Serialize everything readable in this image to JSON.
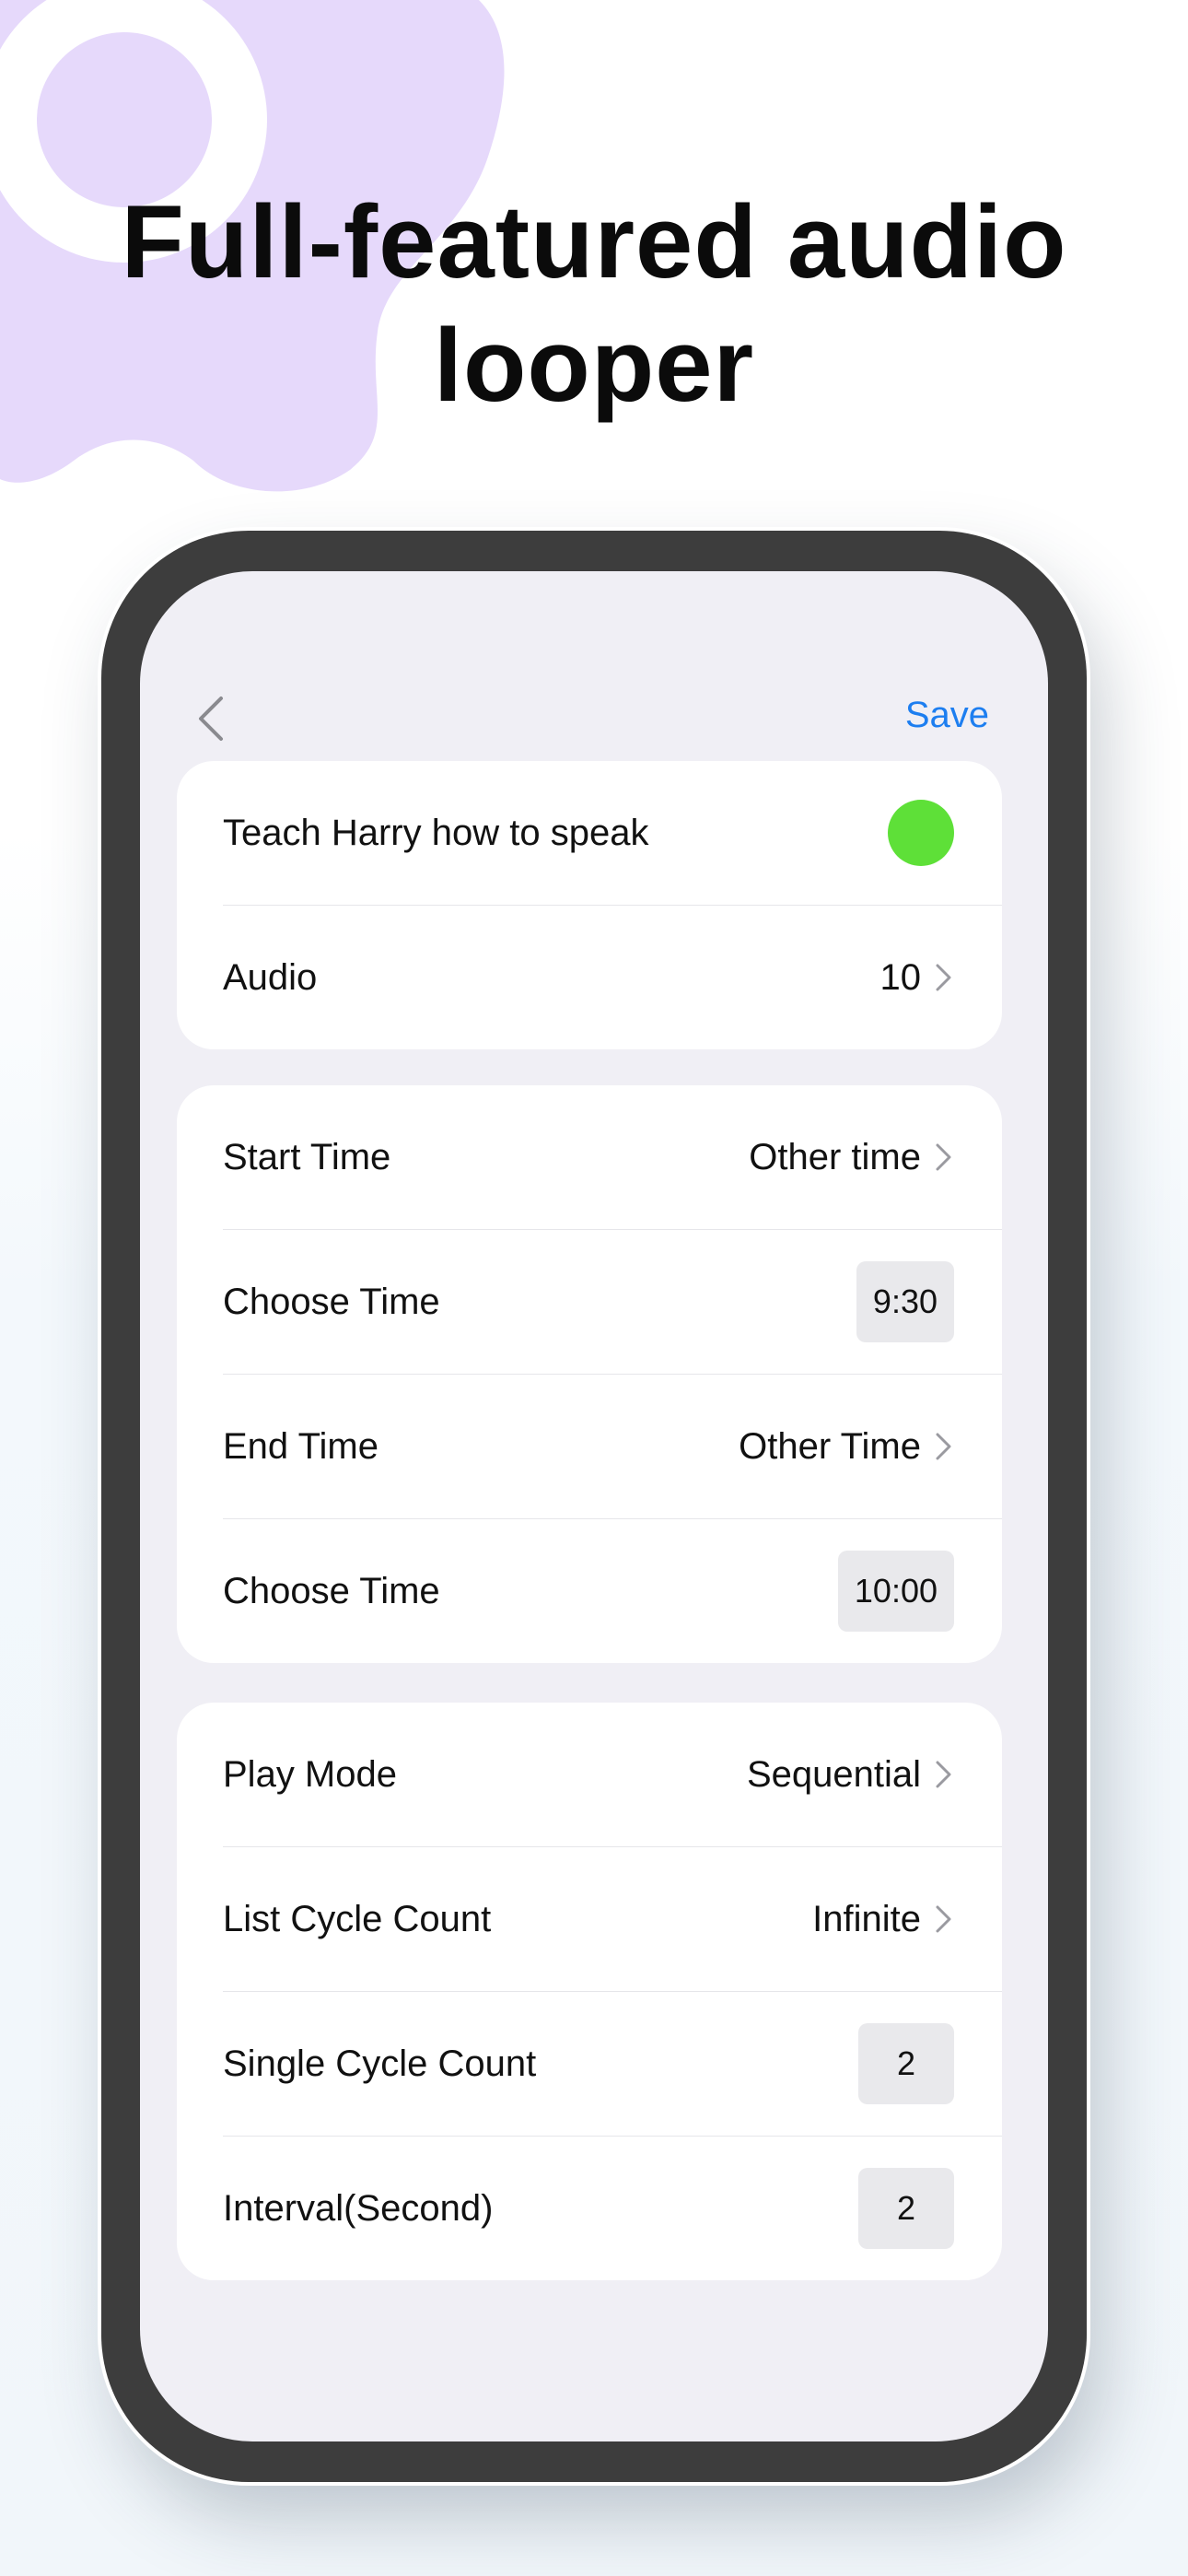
{
  "headline": {
    "line1": "Full-featured audio",
    "line2": "looper"
  },
  "colors": {
    "accent": "#1d7ef0",
    "toggle_on": "#5ee038",
    "blob": "#e6d9fb"
  },
  "navbar": {
    "back_icon": "chevron-left-icon",
    "save_label": "Save"
  },
  "section1": {
    "title_label": "Teach Harry how to speak",
    "title_toggle_on": true,
    "audio_label": "Audio",
    "audio_value": "10"
  },
  "section2": {
    "start_time_label": "Start Time",
    "start_time_value": "Other time",
    "choose_start_label": "Choose Time",
    "choose_start_value": "9:30",
    "end_time_label": "End Time",
    "end_time_value": "Other Time",
    "choose_end_label": "Choose Time",
    "choose_end_value": "10:00"
  },
  "section3": {
    "play_mode_label": "Play Mode",
    "play_mode_value": "Sequential",
    "list_cycle_label": "List Cycle Count",
    "list_cycle_value": "Infinite",
    "single_cycle_label": "Single Cycle Count",
    "single_cycle_value": "2",
    "interval_label": "Interval(Second)",
    "interval_value": "2"
  }
}
